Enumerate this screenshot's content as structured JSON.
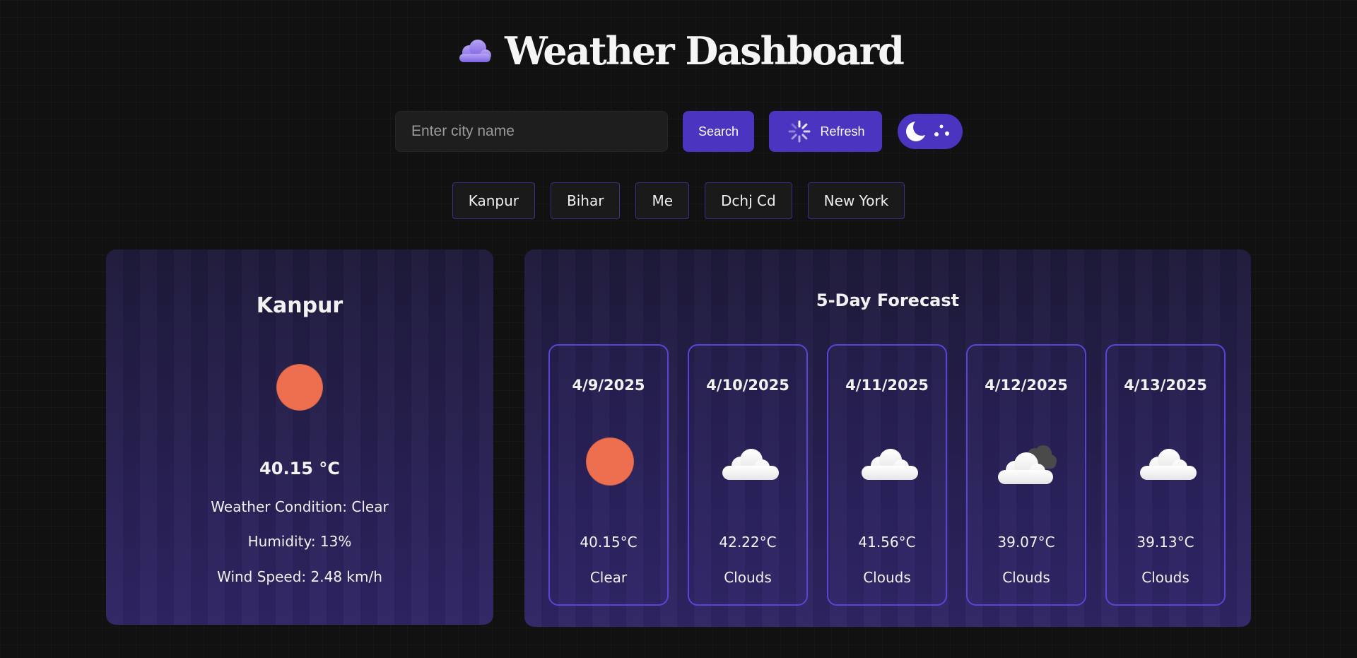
{
  "header": {
    "title": "Weather Dashboard",
    "icon": "cloud-icon"
  },
  "search": {
    "placeholder": "Enter city name",
    "value": "",
    "search_label": "Search",
    "refresh_label": "Refresh",
    "theme_toggle_icon": "moon-icon"
  },
  "recent_cities": [
    "Kanpur",
    "Bihar",
    "Me",
    "Dchj Cd",
    "New York"
  ],
  "current": {
    "city": "Kanpur",
    "icon": "sun-icon",
    "temperature": "40.15 °C",
    "condition_line": "Weather Condition: Clear",
    "humidity_line": "Humidity: 13%",
    "wind_line": "Wind Speed: 2.48 km/h"
  },
  "forecast": {
    "title": "5-Day Forecast",
    "days": [
      {
        "date": "4/9/2025",
        "temp": "40.15°C",
        "condition": "Clear",
        "icon": "sun-icon"
      },
      {
        "date": "4/10/2025",
        "temp": "42.22°C",
        "condition": "Clouds",
        "icon": "cloud-icon"
      },
      {
        "date": "4/11/2025",
        "temp": "41.56°C",
        "condition": "Clouds",
        "icon": "cloud-icon"
      },
      {
        "date": "4/12/2025",
        "temp": "39.07°C",
        "condition": "Clouds",
        "icon": "broken-clouds-icon"
      },
      {
        "date": "4/13/2025",
        "temp": "39.13°C",
        "condition": "Clouds",
        "icon": "cloud-icon"
      }
    ]
  },
  "colors": {
    "background": "#111111",
    "accent": "#4a34c0",
    "card_border": "#5a44d8",
    "sun": "#ee6f4f",
    "cloud": "#f2f2f2"
  }
}
